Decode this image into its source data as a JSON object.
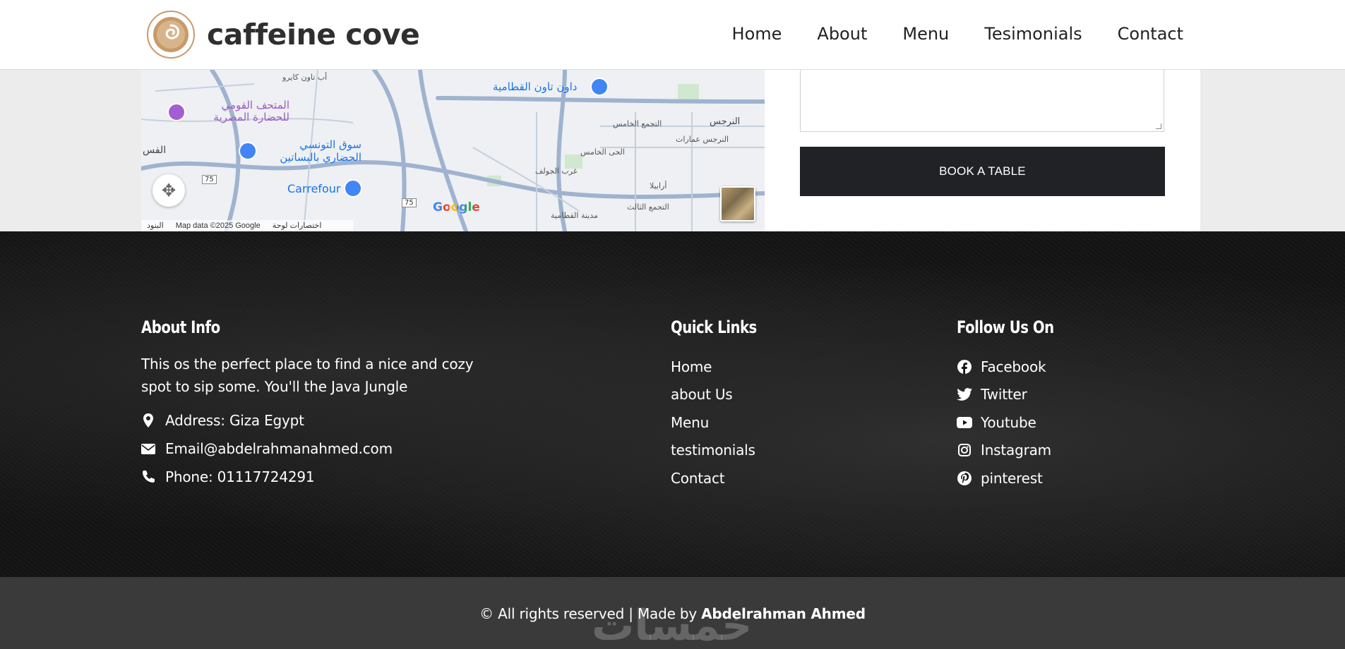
{
  "header": {
    "brand": "caffeine cove",
    "nav": [
      "Home",
      "About",
      "Menu",
      "Tesimonials",
      "Contact"
    ]
  },
  "map": {
    "labels": {
      "museum": "المتحف القومي للحضارة المصرية",
      "souq": "سوق التونسي الحضاري بالبساتين",
      "carrefour": "Carrefour",
      "downtown": "داون تاون القطامية",
      "fifth": "التجمع الخامس",
      "narges": "النرجس عمارات",
      "golf": "غرب الجولف",
      "hay": "الحى الخامس",
      "third": "التجمع الثالث",
      "qattameya": "مدينة القطامية",
      "arabella": "أرابيلا",
      "narges2": "النرجس",
      "abtown": "أب تاون كايرو",
      "fas": "الفس",
      "road75a": "75",
      "road75b": "75"
    },
    "google": "Google",
    "attribution": [
      "البنود",
      "Map data ©2025 Google",
      "اختصارات لوحة المفاتيح"
    ]
  },
  "form": {
    "book_label": "BOOK A TABLE"
  },
  "footer": {
    "about": {
      "heading": "About Info",
      "text": "This os the perfect place to find a nice and cozy spot to sip some. You'll the Java Jungle",
      "address": "Address: Giza Egypt",
      "email": "Email@abdelrahmanahmed.com",
      "phone": "Phone: 01117724291"
    },
    "links": {
      "heading": "Quick Links",
      "items": [
        "Home",
        "about Us",
        "Menu",
        "testimonials",
        "Contact"
      ]
    },
    "social": {
      "heading": "Follow Us On",
      "items": [
        "Facebook",
        "Twitter",
        "Youtube",
        "Instagram",
        "pinterest"
      ]
    }
  },
  "bottom": {
    "copyright_prefix": "© All rights reserved | Made by ",
    "author": "Abdelrahman Ahmed",
    "watermark": "خمسات"
  }
}
